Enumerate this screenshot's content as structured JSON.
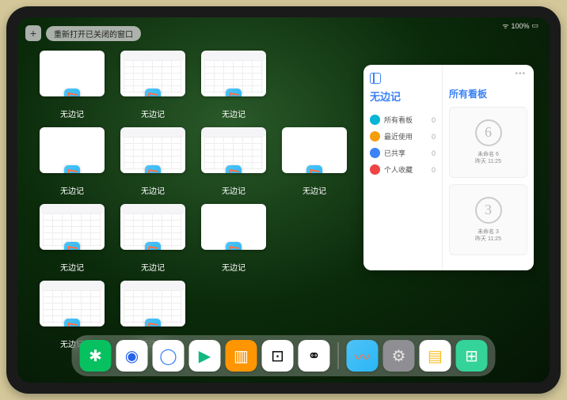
{
  "status": {
    "wifi": "⋮",
    "battery": "100%"
  },
  "topbar": {
    "plus": "+",
    "reopen_label": "重新打开已关闭的窗口"
  },
  "app_name": "无边记",
  "windows": [
    {
      "label": "无边记",
      "variant": "blank"
    },
    {
      "label": "无边记",
      "variant": "calendar"
    },
    {
      "label": "无边记",
      "variant": "calendar"
    },
    {
      "label": "无边记",
      "variant": "blank"
    },
    {
      "label": "无边记",
      "variant": "calendar"
    },
    {
      "label": "无边记",
      "variant": "calendar"
    },
    {
      "label": "无边记",
      "variant": "blank"
    },
    {
      "label": "无边记",
      "variant": "calendar"
    },
    {
      "label": "无边记",
      "variant": "calendar"
    },
    {
      "label": "无边记",
      "variant": "blank"
    },
    {
      "label": "无边记",
      "variant": "calendar"
    },
    {
      "label": "无边记",
      "variant": "calendar"
    }
  ],
  "panel": {
    "sidebar_title": "无边记",
    "main_title": "所有看板",
    "items": [
      {
        "label": "所有看板",
        "count": "0",
        "color": "#06b6d4"
      },
      {
        "label": "最近使用",
        "count": "0",
        "color": "#f59e0b"
      },
      {
        "label": "已共享",
        "count": "0",
        "color": "#3b82f6"
      },
      {
        "label": "个人收藏",
        "count": "0",
        "color": "#ef4444"
      }
    ],
    "boards": [
      {
        "glyph": "6",
        "name": "未命名 6",
        "time": "昨天 11:25"
      },
      {
        "glyph": "3",
        "name": "未命名 3",
        "time": "昨天 11:25"
      }
    ]
  },
  "dock": [
    {
      "name": "wechat",
      "bg": "#07c160",
      "glyph": "✱",
      "fg": "#fff"
    },
    {
      "name": "quark",
      "bg": "#fff",
      "glyph": "◉",
      "fg": "#2563eb"
    },
    {
      "name": "ali-cloud",
      "bg": "#fff",
      "glyph": "◯",
      "fg": "#3b82f6"
    },
    {
      "name": "play",
      "bg": "#fff",
      "glyph": "▶",
      "fg": "#10b981"
    },
    {
      "name": "books",
      "bg": "#ff9500",
      "glyph": "▥",
      "fg": "#fff"
    },
    {
      "name": "dice",
      "bg": "#fff",
      "glyph": "⊡",
      "fg": "#000"
    },
    {
      "name": "graph",
      "bg": "#fff",
      "glyph": "⚭",
      "fg": "#000"
    },
    {
      "name": "freeform",
      "bg": "linear-gradient(135deg,#4fc3f7,#29b6f6)",
      "glyph": "〰",
      "fg": "#ff7043"
    },
    {
      "name": "settings",
      "bg": "#8e8e93",
      "glyph": "⚙",
      "fg": "#e5e5e5"
    },
    {
      "name": "notes",
      "bg": "#fff",
      "glyph": "▤",
      "fg": "#fbbf24"
    },
    {
      "name": "appgrid",
      "bg": "#34d399",
      "glyph": "⊞",
      "fg": "#fff"
    }
  ]
}
